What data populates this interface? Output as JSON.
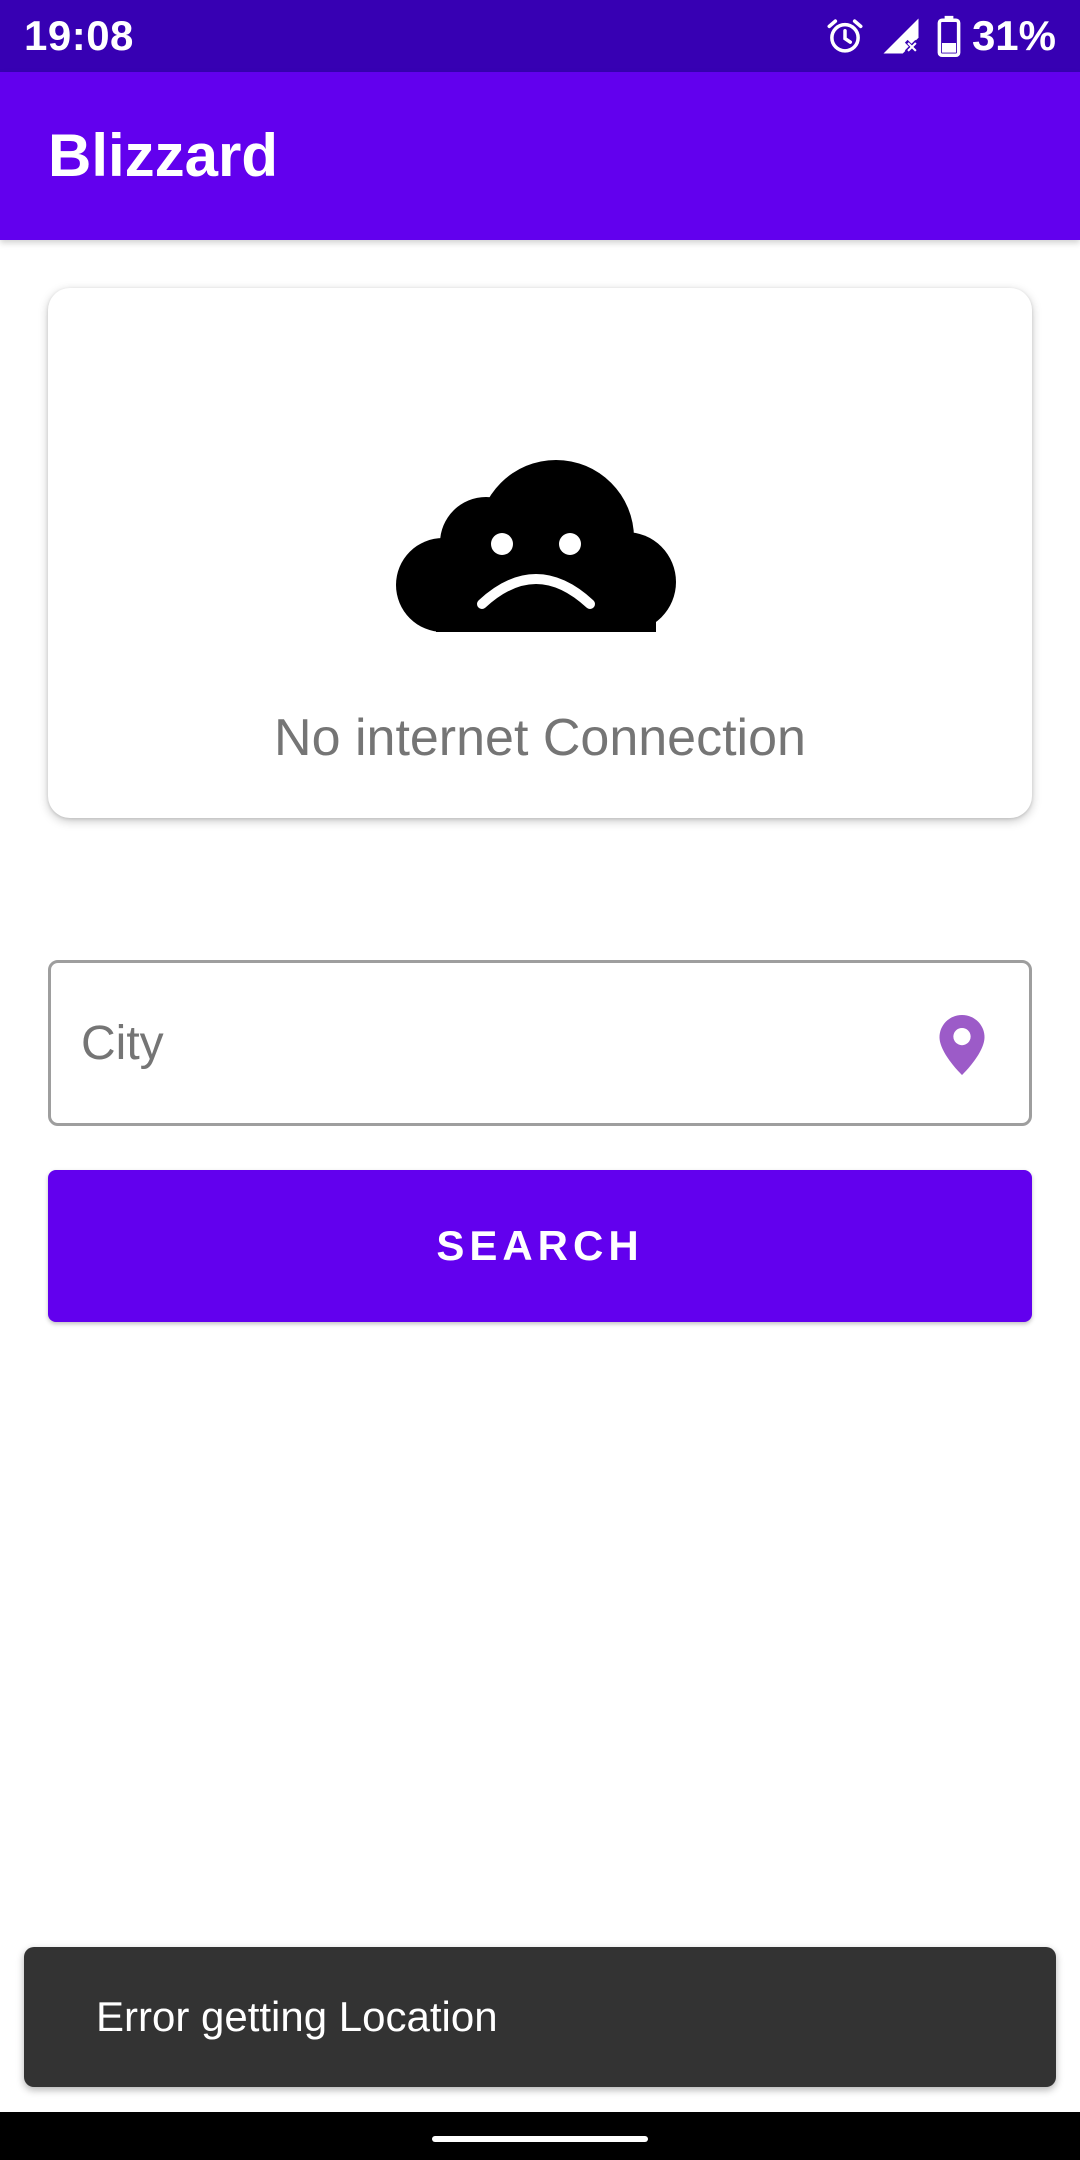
{
  "status_bar": {
    "time": "19:08",
    "battery_percent": "31%",
    "icons": [
      "alarm-icon",
      "signal-off-icon",
      "battery-icon"
    ]
  },
  "app_bar": {
    "title": "Blizzard"
  },
  "status_card": {
    "icon": "sad-cloud-icon",
    "message": "No internet Connection"
  },
  "city_field": {
    "placeholder": "City",
    "value": "",
    "icon": "location-pin-icon"
  },
  "search_button": {
    "label": "SEARCH"
  },
  "snackbar": {
    "message": "Error getting Location"
  },
  "colors": {
    "status_bar": "#3700b3",
    "primary": "#6200ee",
    "pin": "#9c5bc8",
    "snackbar": "#333333"
  }
}
